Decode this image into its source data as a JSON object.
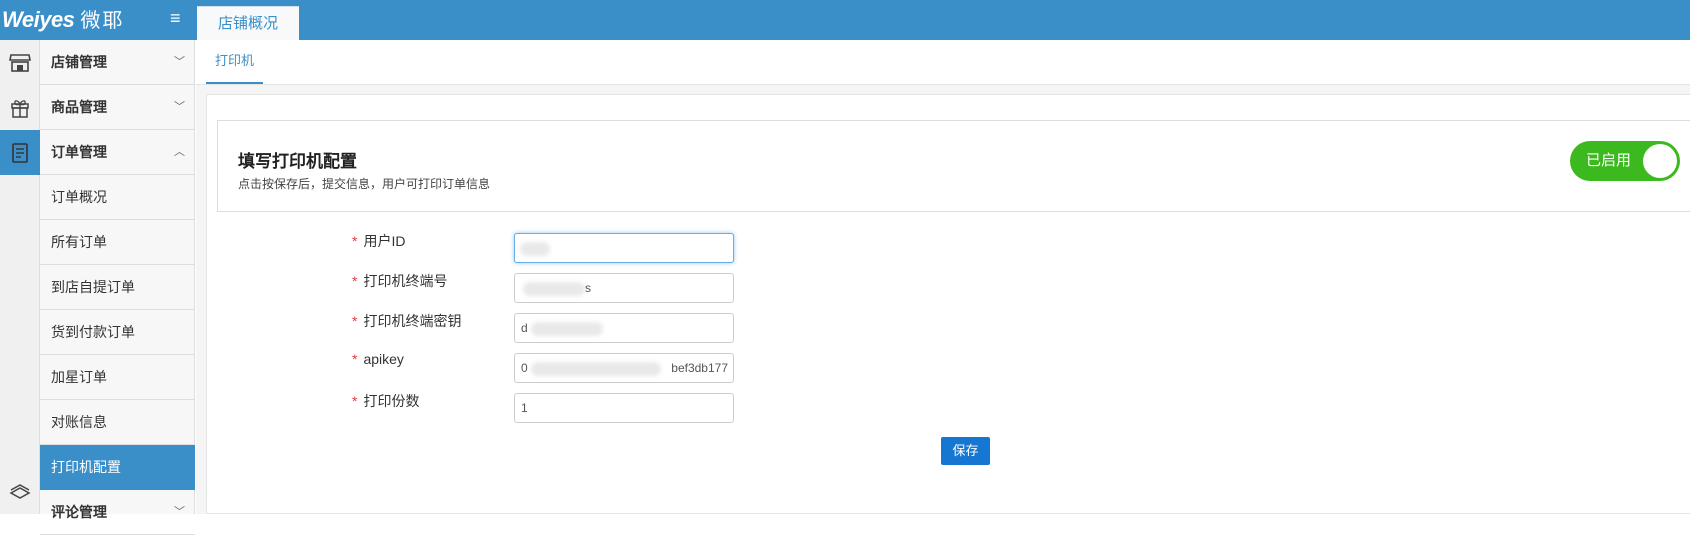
{
  "app": {
    "logo_text": "Weiyes",
    "logo_cn": "微耶",
    "top_tab": "店铺概况"
  },
  "sidebar": {
    "groups": [
      {
        "label": "店铺管理",
        "icon": "store-icon"
      },
      {
        "label": "商品管理",
        "icon": "gift-icon"
      },
      {
        "label": "订单管理",
        "icon": "order-icon"
      }
    ],
    "order_items": [
      "订单概况",
      "所有订单",
      "到店自提订单",
      "货到付款订单",
      "加星订单",
      "对账信息",
      "打印机配置"
    ],
    "last_group": {
      "label": "评论管理",
      "icon": "comment-icon"
    }
  },
  "subnav": {
    "tab": "打印机"
  },
  "config": {
    "title": "填写打印机配置",
    "subtitle": "点击按保存后，提交信息，用户可打印订单信息",
    "switch_label": "已启用"
  },
  "form": {
    "fields": [
      {
        "label": "用户ID",
        "value": ""
      },
      {
        "label": "打印机终端号",
        "value": "s"
      },
      {
        "label": "打印机终端密钥",
        "value": "d"
      },
      {
        "label": "apikey",
        "value": "0",
        "value_tail": "bef3db177"
      },
      {
        "label": "打印份数",
        "value": "1"
      }
    ],
    "save_label": "保存"
  },
  "colors": {
    "accent": "#3b8fc9",
    "switch_on": "#3cb91e",
    "save_button": "#1677d2",
    "required": "#e53935"
  }
}
